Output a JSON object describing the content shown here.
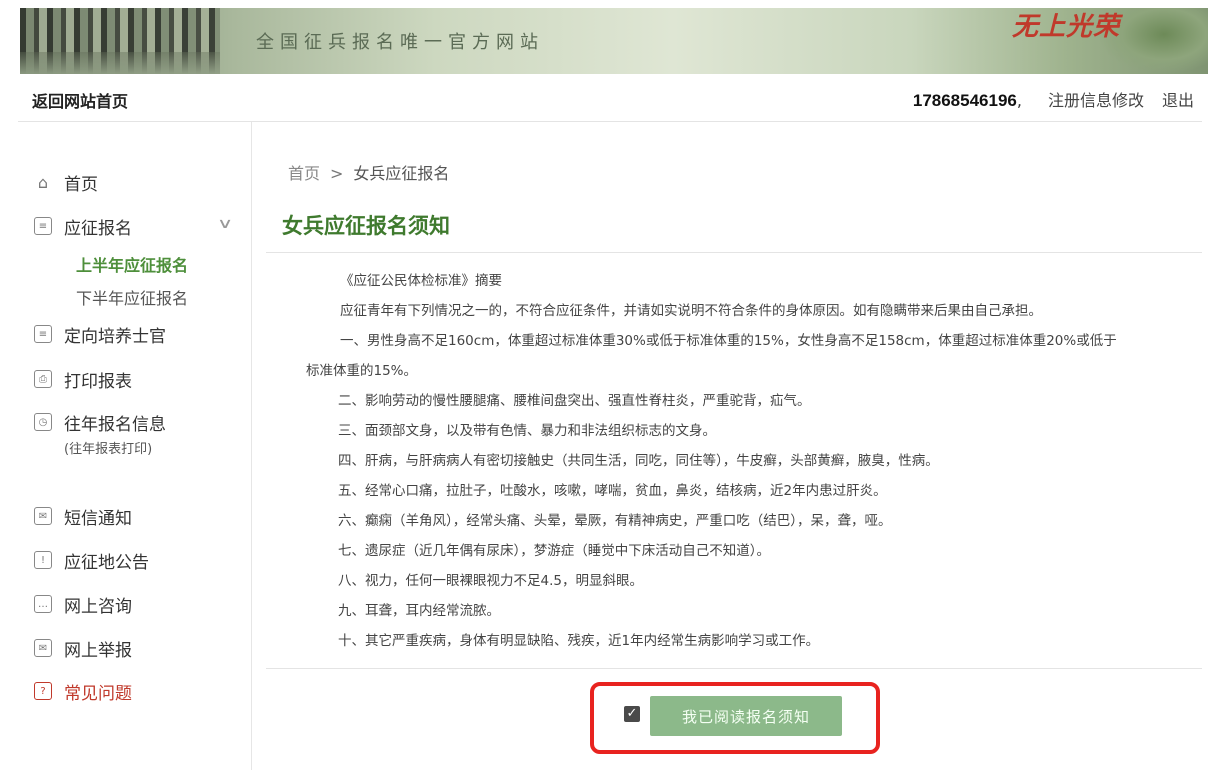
{
  "banner": {
    "slogan": "全国征兵报名唯一官方网站",
    "brand": "无上光荣"
  },
  "topbar": {
    "home_link": "返回网站首页",
    "phone": "17868546196",
    "separator": ",",
    "edit_link": "注册信息修改",
    "logout": "退出"
  },
  "sidebar": {
    "items": [
      {
        "label": "首页",
        "icon": "house-icon"
      },
      {
        "label": "应征报名",
        "icon": "form-icon"
      },
      {
        "label": "定向培养士官",
        "icon": "form-icon"
      },
      {
        "label": "打印报表",
        "icon": "printer-icon"
      },
      {
        "label": "往年报名信息",
        "icon": "history-icon",
        "note": "(往年报表打印)"
      },
      {
        "label": "短信通知",
        "icon": "message-icon"
      },
      {
        "label": "应征地公告",
        "icon": "announcement-icon"
      },
      {
        "label": "网上咨询",
        "icon": "chat-icon"
      },
      {
        "label": "网上举报",
        "icon": "mail-icon"
      },
      {
        "label": "常见问题",
        "icon": "question-icon"
      }
    ],
    "submenu": [
      "上半年应征报名",
      "下半年应征报名"
    ]
  },
  "breadcrumb": {
    "home": "首页",
    "separator": ">",
    "current": "女兵应征报名"
  },
  "page_title": "女兵应征报名须知",
  "notice": {
    "heading": "《应征公民体检标准》摘要",
    "intro": "应征青年有下列情况之一的，不符合应征条件，并请如实说明不符合条件的身体原因。如有隐瞒带来后果由自己承担。",
    "item1_line1": "一、男性身高不足160cm，体重超过标准体重30%或低于标准体重的15%，女性身高不足158cm，体重超过标准体重20%或低于",
    "item1_line2": "标准体重的15%。",
    "item2": "二、影响劳动的慢性腰腿痛、腰椎间盘突出、强直性脊柱炎，严重驼背，疝气。",
    "item3": "三、面颈部文身，以及带有色情、暴力和非法组织标志的文身。",
    "item4": "四、肝病，与肝病病人有密切接触史（共同生活，同吃，同住等），牛皮癣，头部黄癣，腋臭，性病。",
    "item5": "五、经常心口痛，拉肚子，吐酸水，咳嗽，哮喘，贫血，鼻炎，结核病，近2年内患过肝炎。",
    "item6": "六、癫痫（羊角风），经常头痛、头晕，晕厥，有精神病史，严重口吃（结巴），呆，聋，哑。",
    "item7": "七、遗尿症（近几年偶有尿床），梦游症（睡觉中下床活动自己不知道）。",
    "item8": "八、视力，任何一眼裸眼视力不足4.5，明显斜眼。",
    "item9": "九、耳聋，耳内经常流脓。",
    "item10": "十、其它严重疾病，身体有明显缺陷、残疾，近1年内经常生病影响学习或工作。"
  },
  "agree": {
    "checked": true,
    "button_label": "我已阅读报名须知"
  },
  "colors": {
    "accent_green": "#3f7a2e",
    "button_green": "#8cb98a",
    "highlight_red": "#e8231f"
  }
}
